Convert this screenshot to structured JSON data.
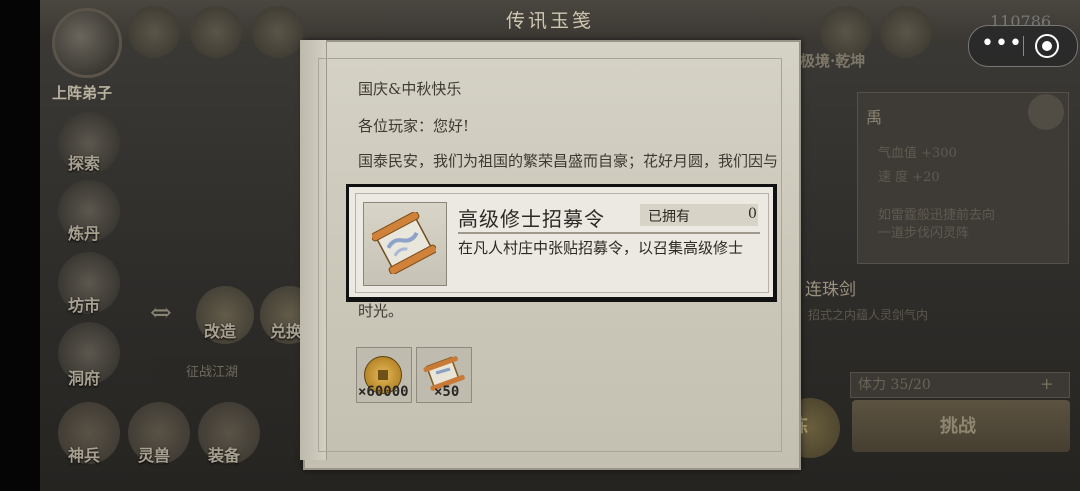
{
  "header": {
    "title": "传讯玉笺"
  },
  "background": {
    "hero_label": "上阵弟子",
    "side_labels": [
      "探索",
      "炼丹",
      "坊市",
      "洞府"
    ],
    "bottom_labels": [
      "神兵",
      "灵兽",
      "装备"
    ],
    "mid_labels": [
      "改造",
      "兑换"
    ],
    "event_label": "征战江湖",
    "banner_text": "极境·乾坤",
    "score": "110786",
    "right_panel": {
      "title": "禹",
      "rows": [
        "气血值 +300",
        "速 度 +20",
        "如雷霆般迅捷前去向",
        "一道步伐闪灵阵"
      ]
    },
    "combo_title": "连珠剑",
    "combo_sub": "招式之内蕴人灵剑气内",
    "stamina_label": "体力 35/20",
    "stamina_plus": "+",
    "refine_label": "炼",
    "fight_label": "挑战"
  },
  "mail": {
    "title": "国庆&中秋快乐",
    "greeting": "各位玩家：您好!",
    "body": "国泰民安，我们为祖国的繁荣昌盛而自豪；花好月圆，我们因与您在游戏世界的相遇而倍感珍惜。感谢您",
    "tail": "时光。",
    "rewards": [
      {
        "name": "coin-reward",
        "icon": "copper-coin-icon",
        "count": "×60000"
      },
      {
        "name": "scroll-reward",
        "icon": "recruit-scroll-icon",
        "count": "×50"
      }
    ]
  },
  "tooltip": {
    "item_name": "高级修士招募令",
    "owned_label": "已拥有",
    "owned_value": "0",
    "description": "在凡人村庄中张贴招募令，以召集高级修士"
  },
  "capsule": {
    "more_symbol": "•••"
  }
}
